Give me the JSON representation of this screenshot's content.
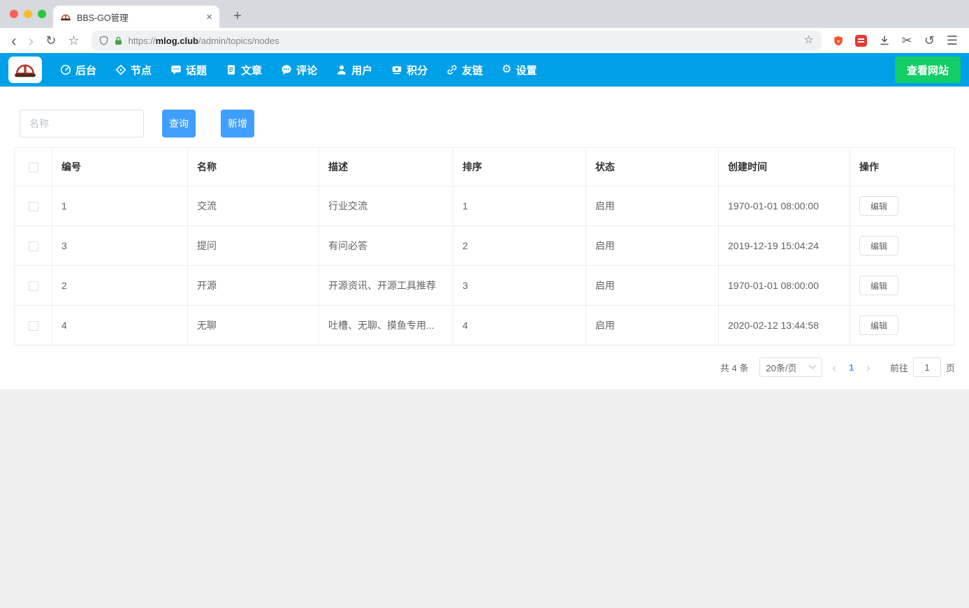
{
  "browser": {
    "tab_title": "BBS-GO管理",
    "url_scheme": "https://",
    "url_host": "mlog.club",
    "url_path": "/admin/topics/nodes"
  },
  "icons": {
    "back": "‹",
    "forward": "›",
    "reload": "↻",
    "bookmark_star": "☆",
    "page_star": "☆",
    "scissors": "✂",
    "history": "↺",
    "menu": "☰",
    "gear": "⚙",
    "new_tab": "+",
    "close_tab": "×",
    "prev_page": "‹",
    "next_page": "›"
  },
  "navbar": {
    "items": [
      {
        "label": "后台",
        "icon": "dashboard-icon"
      },
      {
        "label": "节点",
        "icon": "node-tag-icon"
      },
      {
        "label": "话题",
        "icon": "topic-icon"
      },
      {
        "label": "文章",
        "icon": "article-icon"
      },
      {
        "label": "评论",
        "icon": "comment-icon"
      },
      {
        "label": "用户",
        "icon": "user-icon"
      },
      {
        "label": "积分",
        "icon": "points-icon"
      },
      {
        "label": "友链",
        "icon": "link-icon"
      },
      {
        "label": "设置",
        "icon": "settings-gear-icon"
      }
    ],
    "view_site_label": "查看网站"
  },
  "toolbar": {
    "search_placeholder": "名称",
    "query_label": "查询",
    "add_label": "新增"
  },
  "table": {
    "headers": [
      "编号",
      "名称",
      "描述",
      "排序",
      "状态",
      "创建时间",
      "操作"
    ],
    "rows": [
      {
        "id": "1",
        "name": "交流",
        "description": "行业交流",
        "sort": "1",
        "status": "启用",
        "created_at": "1970-01-01 08:00:00",
        "action": "编辑"
      },
      {
        "id": "3",
        "name": "提问",
        "description": "有问必答",
        "sort": "2",
        "status": "启用",
        "created_at": "2019-12-19 15:04:24",
        "action": "编辑"
      },
      {
        "id": "2",
        "name": "开源",
        "description": "开源资讯、开源工具推荐",
        "sort": "3",
        "status": "启用",
        "created_at": "1970-01-01 08:00:00",
        "action": "编辑"
      },
      {
        "id": "4",
        "name": "无聊",
        "description": "吐槽、无聊、摸鱼专用...",
        "sort": "4",
        "status": "启用",
        "created_at": "2020-02-12 13:44:58",
        "action": "编辑"
      }
    ]
  },
  "pagination": {
    "total": "共 4 条",
    "page_size": "20条/页",
    "current_page": "1",
    "goto_label": "前往",
    "goto_value": "1",
    "page_unit": "页"
  },
  "colors": {
    "navbar": "#00a0e9",
    "primary_button": "#409eff",
    "view_site_button": "#13ce66",
    "table_border": "#ebeef5"
  }
}
